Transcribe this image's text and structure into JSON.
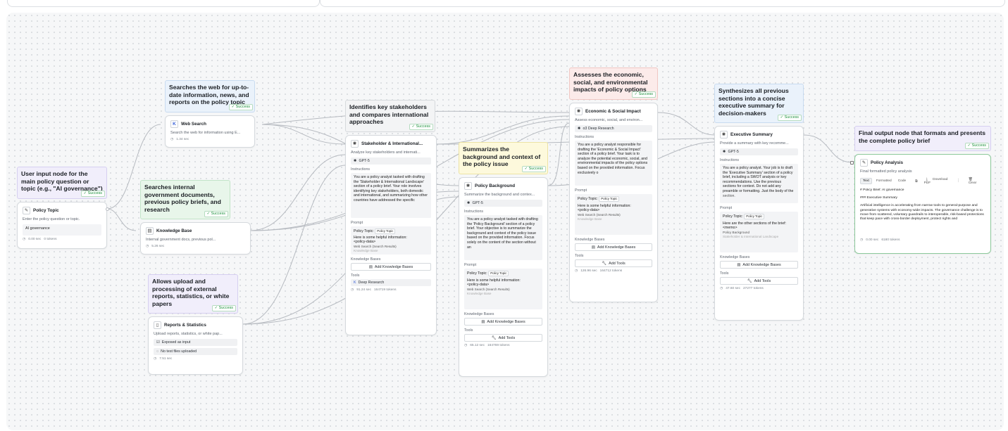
{
  "notes": {
    "user_input": "User input node for the main policy question or topic (e.g., \"AI governance\")",
    "web_search": "Searches the web for up-to-date information, news, and reports on the policy topic",
    "knowledge": "Searches internal government documents, previous policy briefs, and research",
    "uploads": "Allows upload and processing of external reports, statistics, or white papers",
    "stakeholder": "Identifies key stakeholders and compares international approaches",
    "background": "Summarizes the background and context of the policy issue",
    "economic": "Assesses the economic, social, and environmental impacts of policy options",
    "executive": "Synthesizes all previous sections into a concise executive summary for decision-makers",
    "final": "Final output node that formats and presents the complete policy brief",
    "success": "✓ Success"
  },
  "policy_topic": {
    "title": "Policy Topic",
    "desc": "Enter the policy question or topic.",
    "value": "AI governance",
    "time": "0.00 sec",
    "tokens": "0 tokens"
  },
  "web_search": {
    "title": "Web Search",
    "desc": "Search the web for information using E...",
    "time": "1.34 sec"
  },
  "knowledge_base": {
    "title": "Knowledge Base",
    "desc": "Internal government docs, previous pol...",
    "time": "5.26 sec"
  },
  "reports": {
    "title": "Reports & Statistics",
    "desc": "Upload reports, statistics, or white pap...",
    "exposed": "Exposed as input",
    "files": "No test files uploaded",
    "time": "7.51 sec"
  },
  "stakeholder": {
    "title": "Stakeholder & International...",
    "desc": "Analyze key stakeholders and internati...",
    "model": "GPT-5",
    "instructions_label": "Instructions",
    "instructions": "You are a policy analyst tasked with drafting the 'Stakeholder & International Landscape' section of a policy brief. Your role involves identifying key stakeholders, both domestic and international, and summarizing how other countries have addressed the specific",
    "prompt_label": "Prompt",
    "prompt_topic": "Policy Topic:",
    "prompt_tag": "Policy Topic",
    "prompt_info": "Here is some helpful information:",
    "prompt_data": "<policy-data>",
    "prompt_ref1": "Web Search (Search Results)",
    "prompt_ref2": "Knowledge Base",
    "kb_label": "Knowledge Bases",
    "kb_btn": "Add Knowledge Bases",
    "tools_label": "Tools",
    "tool": "Deep Research",
    "time": "91.24 sec",
    "tokens": "164719 tokens"
  },
  "background": {
    "title": "Policy Background",
    "desc": "Summarize the background and contex...",
    "model": "GPT-5",
    "instructions_label": "Instructions",
    "instructions": "You are a policy analyst tasked with drafting the 'Policy Background' section of a policy brief. Your objective is to summarize the background and context of the policy issue based on the provided information. Focus solely on the content of the section without an",
    "prompt_label": "Prompt",
    "prompt_topic": "Policy Topic:",
    "prompt_tag": "Policy Topic",
    "prompt_info": "Here is some helpful information:",
    "prompt_data": "<policy-data>",
    "prompt_ref1": "Web Search (Search Results)",
    "prompt_ref2": "Knowledge Base",
    "kb_label": "Knowledge Bases",
    "kb_btn": "Add Knowledge Bases",
    "tools_label": "Tools",
    "tools_btn": "Add Tools",
    "time": "65.12 sec",
    "tokens": "164769 tokens"
  },
  "economic": {
    "title": "Economic & Social Impact",
    "desc": "Assess economic, social, and environ...",
    "model": "o3 Deep Research",
    "instructions_label": "Instructions",
    "instructions": "You are a policy analyst responsible for drafting the 'Economic & Social Impact' section of a policy brief. Your task is to analyze the potential economic, social, and environmental impacts of the policy options based on the provided information. Focus exclusively o",
    "prompt_label": "Prompt",
    "prompt_topic": "Policy Topic:",
    "prompt_tag": "Policy Topic",
    "prompt_info": "Here is some helpful information:",
    "prompt_data": "<policy-data>",
    "prompt_ref1": "Web Search (Search Results)",
    "prompt_ref2": "Knowledge Base",
    "kb_label": "Knowledge Bases",
    "kb_btn": "Add Knowledge Bases",
    "tools_label": "Tools",
    "tools_btn": "Add Tools",
    "time": "126.96 sec",
    "tokens": "164712 tokens"
  },
  "executive": {
    "title": "Executive Summary",
    "desc": "Provide a summary with key recomme...",
    "model": "GPT-5",
    "instructions_label": "Instructions",
    "instructions": "You are a policy analyst. Your job is to draft the 'Executive Summary' section of a policy brief, including a SWOT analysis or key recommendations. Use the previous sections for context. Do not add any preamble or formatting. Just the body of the section.",
    "prompt_label": "Prompt",
    "prompt_topic": "Policy Topic:",
    "prompt_tag": "Policy Topic",
    "prompt_info": "Here are the other sections of the brief:",
    "prompt_data": "<memo>",
    "prompt_ref1": "Policy Background",
    "prompt_ref2": "Stakeholder & International Landscape",
    "kb_label": "Knowledge Bases",
    "kb_btn": "Add Knowledge Bases",
    "tools_label": "Tools",
    "tools_btn": "Add Tools",
    "time": "47.60 sec",
    "tokens": "27277 tokens"
  },
  "analysis": {
    "title": "Policy Analysis",
    "desc": "Final formatted policy analysis",
    "tab_text": "Text",
    "tab_formatted": "Formatted",
    "tab_code": "Code",
    "download": "Download PDF",
    "clear": "Clear",
    "line1": "# Policy Brief: AI governance",
    "line2": "### Executive Summary",
    "line3": "Artificial intelligence is accelerating from narrow tools to general-purpose and generative systems with economy-wide impacts. The governance challenge is to move from scattered, voluntary guardrails to interoperable, risk-based protections that keep pace with cross-border deployment, protect rights and",
    "time": "0.00 sec",
    "tokens": "6180 tokens"
  }
}
